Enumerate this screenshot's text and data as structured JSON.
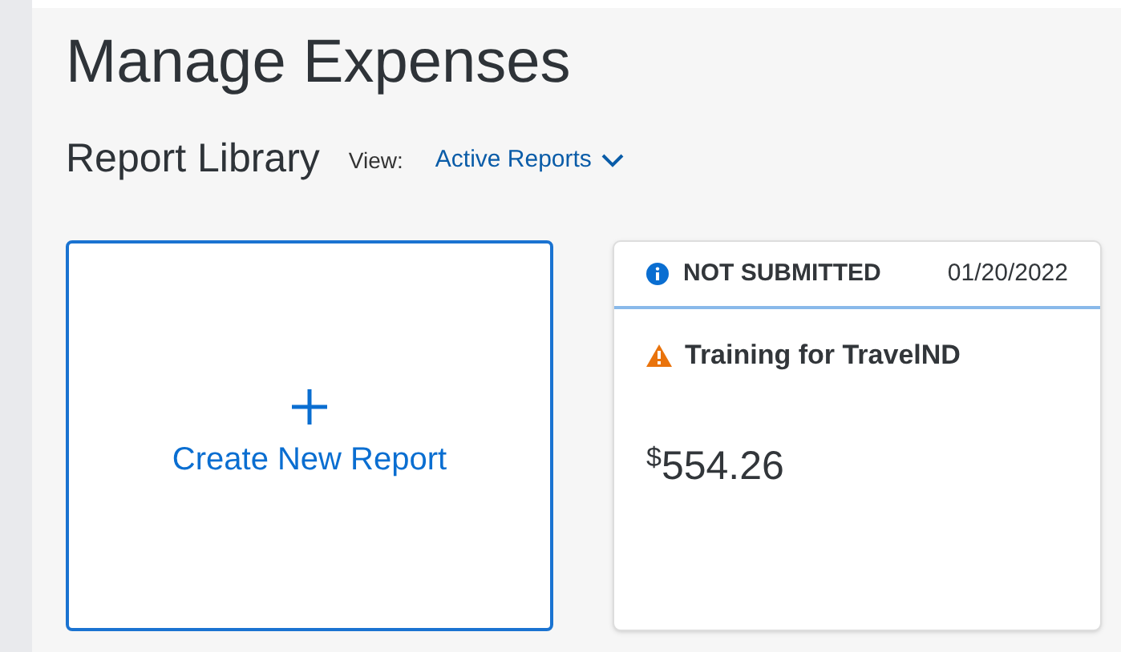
{
  "title": "Manage Expenses",
  "library": {
    "title": "Report Library",
    "view_label": "View:",
    "view_value": "Active Reports"
  },
  "create_card": {
    "label": "Create New Report"
  },
  "reports": [
    {
      "status": "NOT SUBMITTED",
      "date": "01/20/2022",
      "name": "Training for TravelND",
      "warning": true,
      "currency": "$",
      "amount": "554.26"
    }
  ]
}
